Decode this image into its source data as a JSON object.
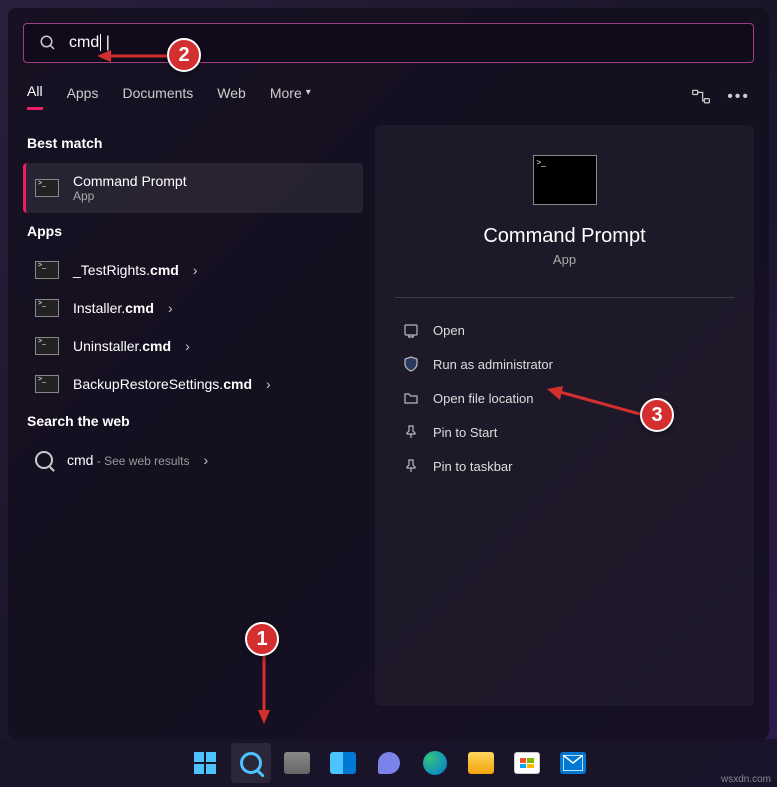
{
  "search": {
    "query": "cmd"
  },
  "tabs": {
    "all": "All",
    "apps": "Apps",
    "documents": "Documents",
    "web": "Web",
    "more": "More"
  },
  "sections": {
    "best_match": "Best match",
    "apps": "Apps",
    "web": "Search the web"
  },
  "best_match": {
    "title": "Command Prompt",
    "subtitle": "App"
  },
  "apps_list": [
    {
      "prefix": "_TestRights.",
      "ext": "cmd"
    },
    {
      "prefix": "Installer.",
      "ext": "cmd"
    },
    {
      "prefix": "Uninstaller.",
      "ext": "cmd"
    },
    {
      "prefix": "BackupRestoreSettings.",
      "ext": "cmd"
    }
  ],
  "web_result": {
    "term": "cmd",
    "suffix": " - See web results"
  },
  "detail": {
    "title": "Command Prompt",
    "type": "App"
  },
  "actions": {
    "open": "Open",
    "run_admin": "Run as administrator",
    "file_loc": "Open file location",
    "pin_start": "Pin to Start",
    "pin_taskbar": "Pin to taskbar"
  },
  "annotations": {
    "a1": "1",
    "a2": "2",
    "a3": "3"
  },
  "watermark": "wsxdn.com"
}
